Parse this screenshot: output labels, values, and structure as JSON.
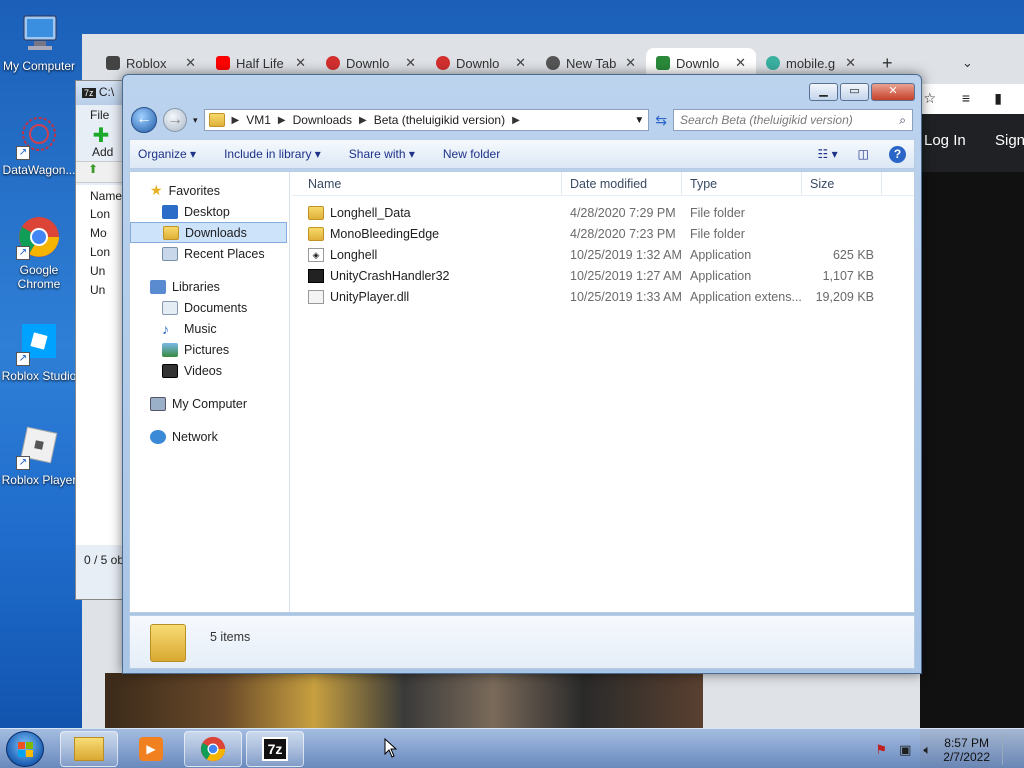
{
  "desktop": {
    "icons": [
      {
        "label": "My Computer"
      },
      {
        "label": "DataWagon..."
      },
      {
        "label": "Google Chrome"
      },
      {
        "label": "Roblox Studio"
      },
      {
        "label": "Roblox Player"
      }
    ]
  },
  "chrome": {
    "tabs": [
      {
        "label": "Roblox",
        "color": "#444444"
      },
      {
        "label": "Half Life",
        "color": "#ff0000"
      },
      {
        "label": "Downlo",
        "color": "#d32f2f"
      },
      {
        "label": "Downlo",
        "color": "#d32f2f"
      },
      {
        "label": "New Tab",
        "color": "#555555"
      },
      {
        "label": "Downlo",
        "color": "#2a8a3a"
      },
      {
        "label": "mobile.g",
        "color": "#3ab0a0"
      }
    ],
    "login": "Log In",
    "signup": "Sign"
  },
  "sevenzip": {
    "title": "C:\\",
    "menu_file": "File",
    "add_label": "Add",
    "col_name": "Name",
    "rows": [
      "Lon",
      "Mo",
      "Lon",
      "Un",
      "Un"
    ],
    "status": "0 / 5 ob"
  },
  "explorer": {
    "breadcrumb": [
      "VM1",
      "Downloads",
      "Beta (theluigikid version)"
    ],
    "search_placeholder": "Search Beta (theluigikid version)",
    "toolbar": {
      "organize": "Organize",
      "include_library": "Include in library",
      "share_with": "Share with",
      "new_folder": "New folder"
    },
    "nav": {
      "favorites": "Favorites",
      "desktop": "Desktop",
      "downloads": "Downloads",
      "recent_places": "Recent Places",
      "libraries": "Libraries",
      "documents": "Documents",
      "music": "Music",
      "pictures": "Pictures",
      "videos": "Videos",
      "my_computer": "My Computer",
      "network": "Network"
    },
    "columns": {
      "name": "Name",
      "date": "Date modified",
      "type": "Type",
      "size": "Size"
    },
    "files": [
      {
        "name": "Longhell_Data",
        "date": "4/28/2020 7:29 PM",
        "type": "File folder",
        "size": "",
        "icon": "folder"
      },
      {
        "name": "MonoBleedingEdge",
        "date": "4/28/2020 7:23 PM",
        "type": "File folder",
        "size": "",
        "icon": "folder"
      },
      {
        "name": "Longhell",
        "date": "10/25/2019 1:32 AM",
        "type": "Application",
        "size": "625 KB",
        "icon": "unity"
      },
      {
        "name": "UnityCrashHandler32",
        "date": "10/25/2019 1:27 AM",
        "type": "Application",
        "size": "1,107 KB",
        "icon": "crash"
      },
      {
        "name": "UnityPlayer.dll",
        "date": "10/25/2019 1:33 AM",
        "type": "Application extens...",
        "size": "19,209 KB",
        "icon": "dll"
      }
    ],
    "item_count": "5 items"
  },
  "taskbar": {
    "time": "8:57 PM",
    "date": "2/7/2022"
  }
}
